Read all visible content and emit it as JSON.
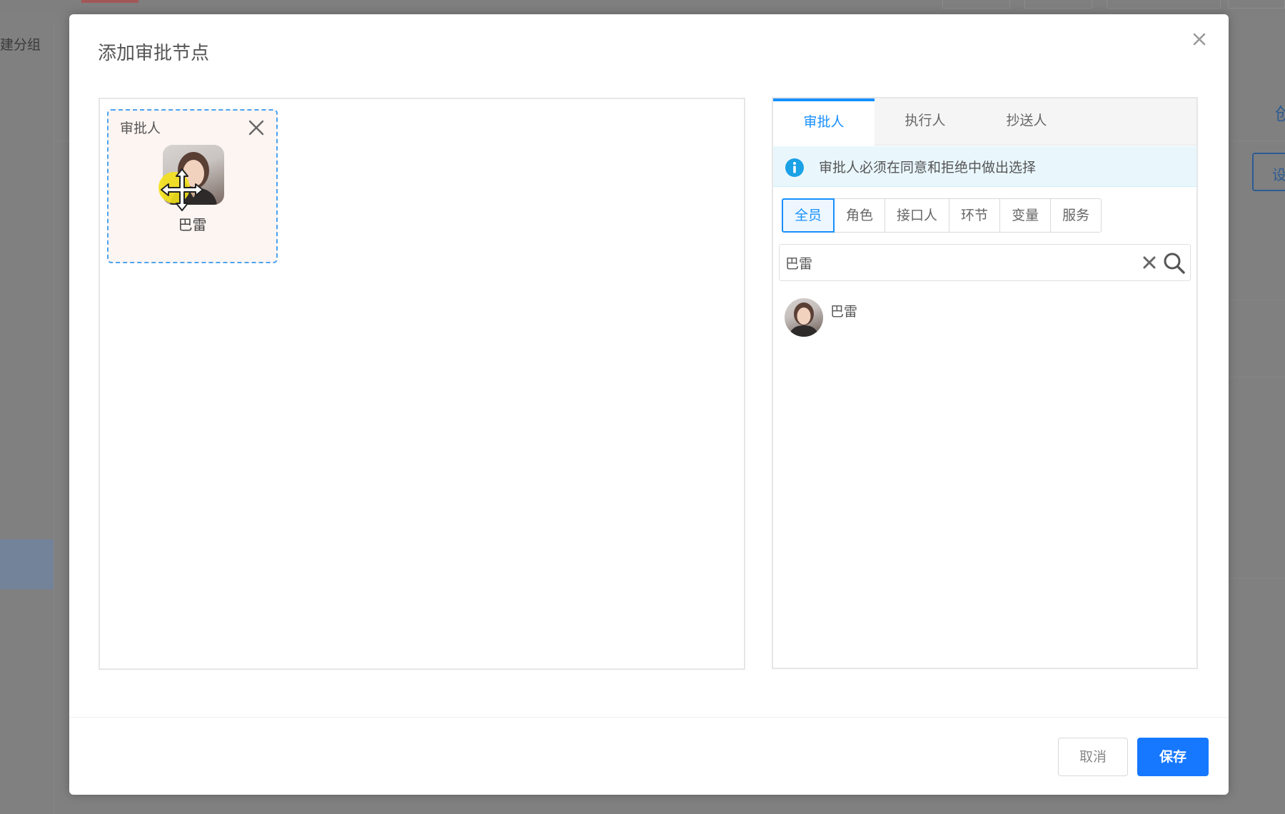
{
  "background": {
    "sidebar_label": "建分组",
    "right_char": "创",
    "right_button_label": "设"
  },
  "modal": {
    "title": "添加审批节点",
    "close_icon": "close-icon"
  },
  "canvas": {
    "node": {
      "label": "审批人",
      "name": "巴雷",
      "close_icon": "close-icon",
      "cursor_icon": "move-cursor-icon"
    }
  },
  "picker": {
    "tabs": [
      {
        "label": "审批人",
        "active": true
      },
      {
        "label": "执行人",
        "active": false
      },
      {
        "label": "抄送人",
        "active": false
      }
    ],
    "info": {
      "icon": "info-icon",
      "text": "审批人必须在同意和拒绝中做出选择"
    },
    "filters": [
      {
        "label": "全员",
        "active": true
      },
      {
        "label": "角色",
        "active": false
      },
      {
        "label": "接口人",
        "active": false
      },
      {
        "label": "环节",
        "active": false
      },
      {
        "label": "变量",
        "active": false
      },
      {
        "label": "服务",
        "active": false
      }
    ],
    "search": {
      "value": "巴雷",
      "clear_icon": "clear-icon",
      "search_icon": "search-icon"
    },
    "results": [
      {
        "name": "巴雷"
      }
    ]
  },
  "footer": {
    "cancel_label": "取消",
    "save_label": "保存"
  },
  "colors": {
    "accent": "#1890ff",
    "primary_button": "#1677ff",
    "info_bg": "#e9f7fd",
    "node_border": "#4aa3f0",
    "overlay": "#808080"
  }
}
